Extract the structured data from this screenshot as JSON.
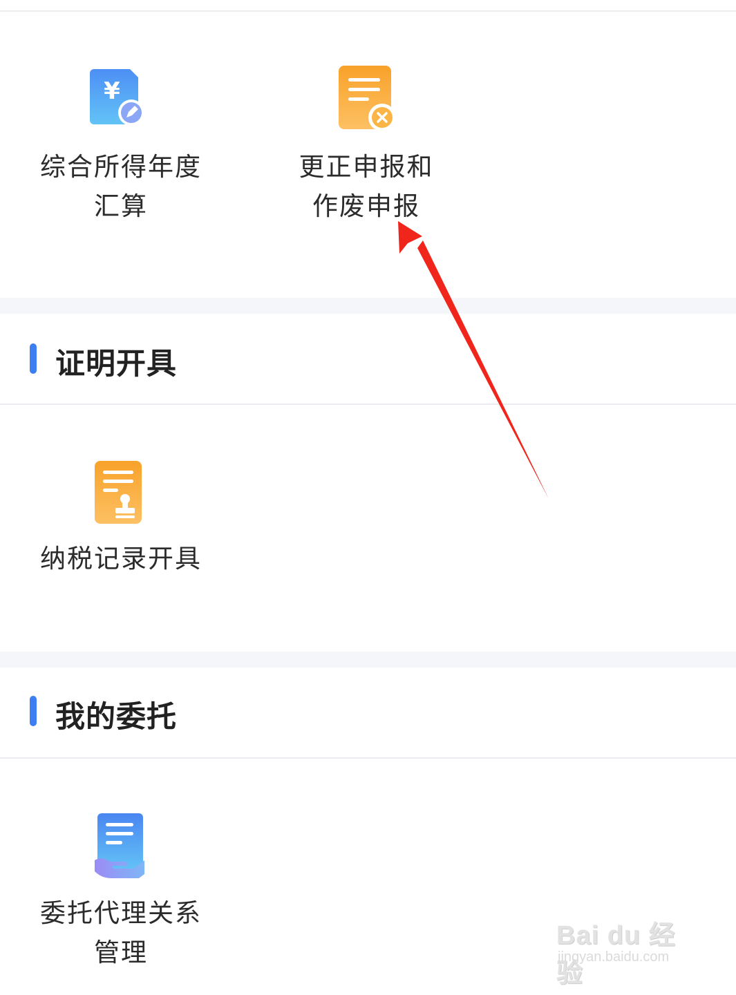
{
  "tax_filing": {
    "items": [
      {
        "label": "综合所得年度\n汇算",
        "icon": "yen-document-edit-icon"
      },
      {
        "label": "更正申报和\n作废申报",
        "icon": "document-cancel-icon"
      }
    ]
  },
  "certificates": {
    "title": "证明开具",
    "items": [
      {
        "label": "纳税记录开具",
        "icon": "document-stamp-icon"
      }
    ]
  },
  "delegation": {
    "title": "我的委托",
    "items": [
      {
        "label": "委托代理关系\n管理",
        "icon": "document-hand-icon"
      }
    ]
  },
  "watermark": {
    "main": "Bai du 经验",
    "sub": "jingyan.baidu.com"
  },
  "colors": {
    "accent": "#3d7ff3",
    "arrow": "#f0261c",
    "orange": "#f9a52d",
    "blue": "#4a97f2"
  }
}
